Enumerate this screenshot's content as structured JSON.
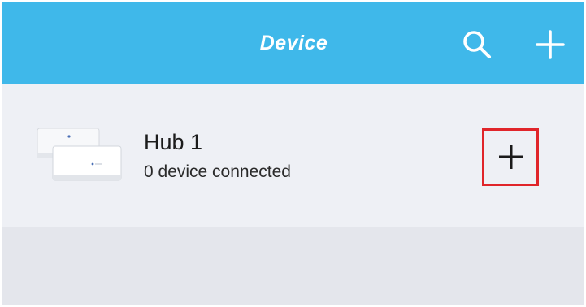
{
  "header": {
    "title": "Device",
    "background_color": "#3fb8ea",
    "actions": [
      {
        "icon": "search-icon"
      },
      {
        "icon": "plus-icon"
      }
    ]
  },
  "devices": [
    {
      "name": "Hub 1",
      "status": "0 device connected",
      "image_icon": "hub-device-icon",
      "action_icon": "plus-icon",
      "action_highlight_color": "#e0252a"
    }
  ]
}
